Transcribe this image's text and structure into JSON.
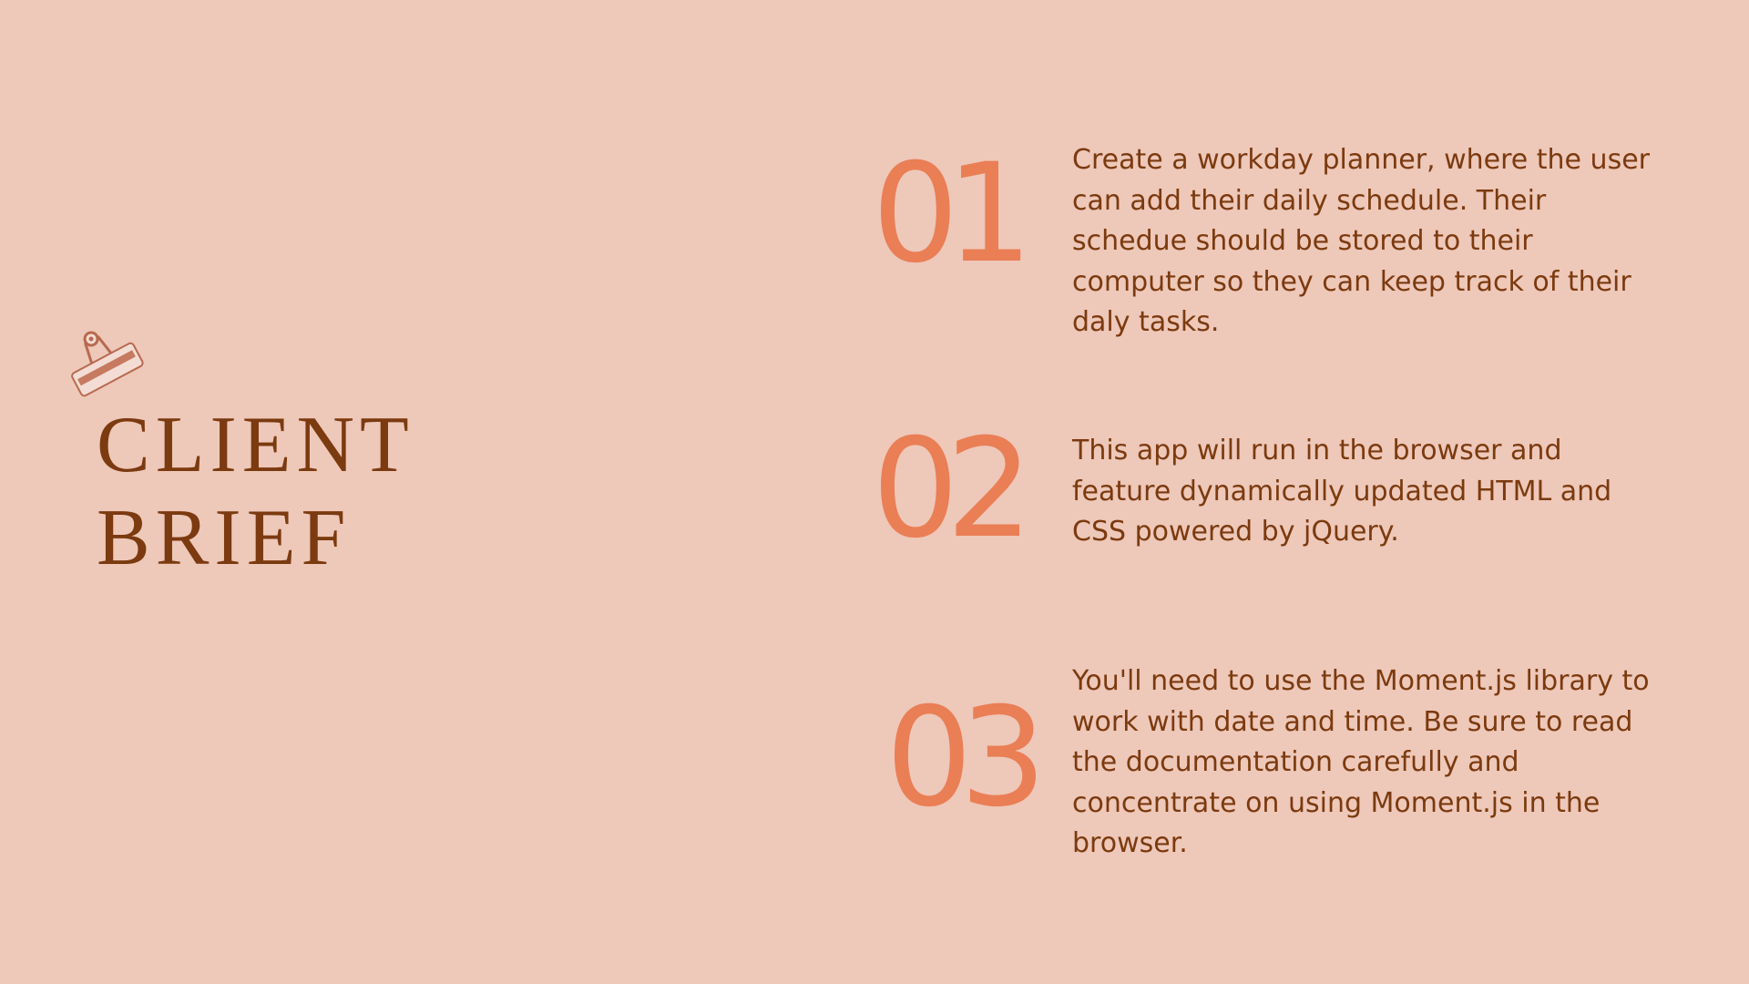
{
  "title": {
    "line1": "CLIENT",
    "line2": "BRIEF"
  },
  "items": [
    {
      "number": "01",
      "text": "Create a workday planner, where the user can add their daily schedule. Their schedue should be stored to their computer so they can keep track of their daly tasks."
    },
    {
      "number": "02",
      "text": "This app will run in the browser and feature dynamically updated HTML and CSS powered by jQuery."
    },
    {
      "number": "03",
      "text": "You'll need to use the Moment.js library to work with date and time. Be sure to read the documentation carefully and concentrate on using Moment.js in the browser."
    }
  ],
  "colors": {
    "background": "#EEC8B9",
    "heading": "#7B3A0F",
    "accent_number": "#EA7E55",
    "body_text": "#7B3A0F"
  },
  "icons": {
    "clip": "binder-clip-icon"
  }
}
